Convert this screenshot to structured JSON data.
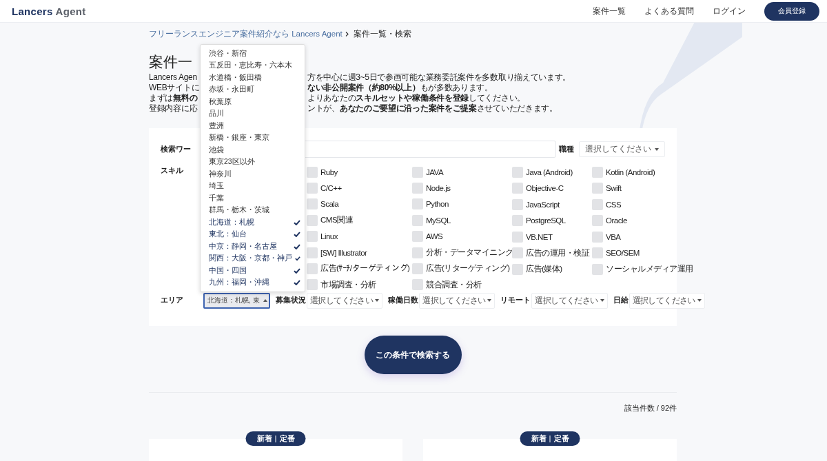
{
  "header": {
    "logo": {
      "primary": "Lancers",
      "secondary": "Agent"
    },
    "nav": [
      "案件一覧",
      "よくある質問",
      "ログイン"
    ],
    "register_button": "会員登録"
  },
  "breadcrumb": {
    "link": "フリーランスエンジニア案件紹介なら Lancers Agent",
    "current": "案件一覧・検索"
  },
  "heading": "案件一",
  "intro_lines": [
    {
      "left": "Lancers Agen",
      "right": "方を中心に週3~5日で参画可能な業務委託案件を多数取り揃えています。"
    },
    {
      "left": "WEBサイトに",
      "right": "**ない非公開案件（約80%以上）**もが多数あります。"
    },
    {
      "left": "まずは**無料の**",
      "right": "よりあなたの**スキルセットや稼働条件を登録**してください。"
    },
    {
      "left": "登録内容に応",
      "right": "ントが、**あなたのご要望に沿った案件をご提案**させていただきます。"
    }
  ],
  "search": {
    "keyword_label": "検索ワー",
    "job_type": {
      "label": "職種",
      "placeholder": "選択してください"
    },
    "skill_label": "スキル",
    "skill_columns": [
      [
        {
          "label": "Ruby",
          "checked": false
        },
        {
          "label": "C/C++",
          "checked": false
        },
        {
          "label": "Scala",
          "checked": false
        },
        {
          "label": "CMS関連",
          "checked": false
        },
        {
          "label": "Linux",
          "checked": false
        },
        {
          "label": "[SW] Illustrator",
          "checked": false
        },
        {
          "label": "広告(ｻｰﾁ/ターゲティング)",
          "checked": false
        },
        {
          "label": "市場調査・分析",
          "checked": false
        }
      ],
      [
        {
          "label": "JAVA",
          "checked": false
        },
        {
          "label": "Node.js",
          "checked": false
        },
        {
          "label": "Python",
          "checked": false
        },
        {
          "label": "MySQL",
          "checked": false
        },
        {
          "label": "AWS",
          "checked": false
        },
        {
          "label": "分析・データマイニング",
          "checked": false
        },
        {
          "label": "広告(リターゲティング)",
          "checked": false
        },
        {
          "label": "競合調査・分析",
          "checked": false
        }
      ],
      [
        {
          "label": "Java (Android)",
          "checked": false
        },
        {
          "label": "Objective-C",
          "checked": false
        },
        {
          "label": "JavaScript",
          "checked": false
        },
        {
          "label": "PostgreSQL",
          "checked": false
        },
        {
          "label": "VB.NET",
          "checked": false
        },
        {
          "label": "広告の運用・検証",
          "checked": false
        },
        {
          "label": "広告(媒体)",
          "checked": false
        }
      ],
      [
        {
          "label": "Kotlin (Android)",
          "checked": false
        },
        {
          "label": "Swift",
          "checked": false
        },
        {
          "label": "CSS",
          "checked": false
        },
        {
          "label": "Oracle",
          "checked": false
        },
        {
          "label": "VBA",
          "checked": false
        },
        {
          "label": "SEO/SEM",
          "checked": false
        },
        {
          "label": "ソーシャルメディア運用",
          "checked": false
        }
      ]
    ],
    "area": {
      "label": "エリア",
      "value": "北海道：札幌, 東",
      "expanded": true,
      "options": [
        {
          "label": "渋谷・新宿",
          "selected": false
        },
        {
          "label": "五反田・恵比寿・六本木",
          "selected": false
        },
        {
          "label": "水道橋・飯田橋",
          "selected": false
        },
        {
          "label": "赤坂・永田町",
          "selected": false
        },
        {
          "label": "秋葉原",
          "selected": false
        },
        {
          "label": "品川",
          "selected": false
        },
        {
          "label": "豊洲",
          "selected": false
        },
        {
          "label": "新橋・銀座・東京",
          "selected": false
        },
        {
          "label": "池袋",
          "selected": false
        },
        {
          "label": "東京23区以外",
          "selected": false
        },
        {
          "label": "神奈川",
          "selected": false
        },
        {
          "label": "埼玉",
          "selected": false
        },
        {
          "label": "千葉",
          "selected": false
        },
        {
          "label": "群馬・栃木・茨城",
          "selected": false
        },
        {
          "label": "北海道：札幌",
          "selected": true
        },
        {
          "label": "東北：仙台",
          "selected": true
        },
        {
          "label": "中京：静岡・名古屋",
          "selected": true
        },
        {
          "label": "関西：大阪・京都・神戸",
          "selected": true
        },
        {
          "label": "中国・四国",
          "selected": true
        },
        {
          "label": "九州：福岡・沖縄",
          "selected": true
        }
      ]
    },
    "filters": [
      {
        "label": "募集状況",
        "placeholder": "選択してください"
      },
      {
        "label": "稼働日数",
        "placeholder": "選択してください"
      },
      {
        "label": "リモート",
        "placeholder": "選択してください"
      },
      {
        "label": "日給",
        "placeholder": "選択してください"
      }
    ]
  },
  "search_button": "この条件で検索する",
  "result_count": "該当件数 / 92件",
  "cards": [
    {
      "badge": [
        "新着",
        "定番"
      ]
    },
    {
      "badge": [
        "新着",
        "定番"
      ]
    }
  ]
}
